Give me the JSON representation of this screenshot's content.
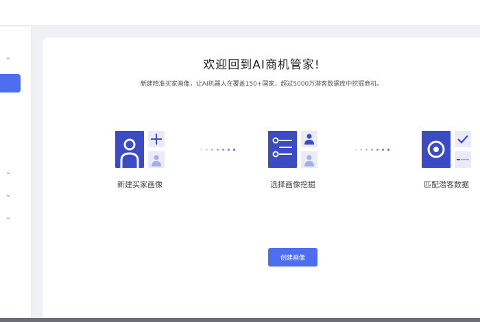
{
  "welcome": {
    "title": "欢迎回到AI商机管家!",
    "subtitle": "新建精准买家画像，让AI机器人在覆盖150+国家，超过5000万潜客数据库中挖掘商机。"
  },
  "steps": [
    {
      "label": "新建买家画像",
      "icon": "person-add-icon"
    },
    {
      "label": "选择画像挖掘",
      "icon": "list-select-icon"
    },
    {
      "label": "匹配潜客数据",
      "icon": "target-match-icon"
    }
  ],
  "cta": {
    "label": "创建画像"
  },
  "colors": {
    "accent": "#4e6ef2",
    "tile": "#3a4bc4",
    "tile_light": "#e9ecf8"
  }
}
